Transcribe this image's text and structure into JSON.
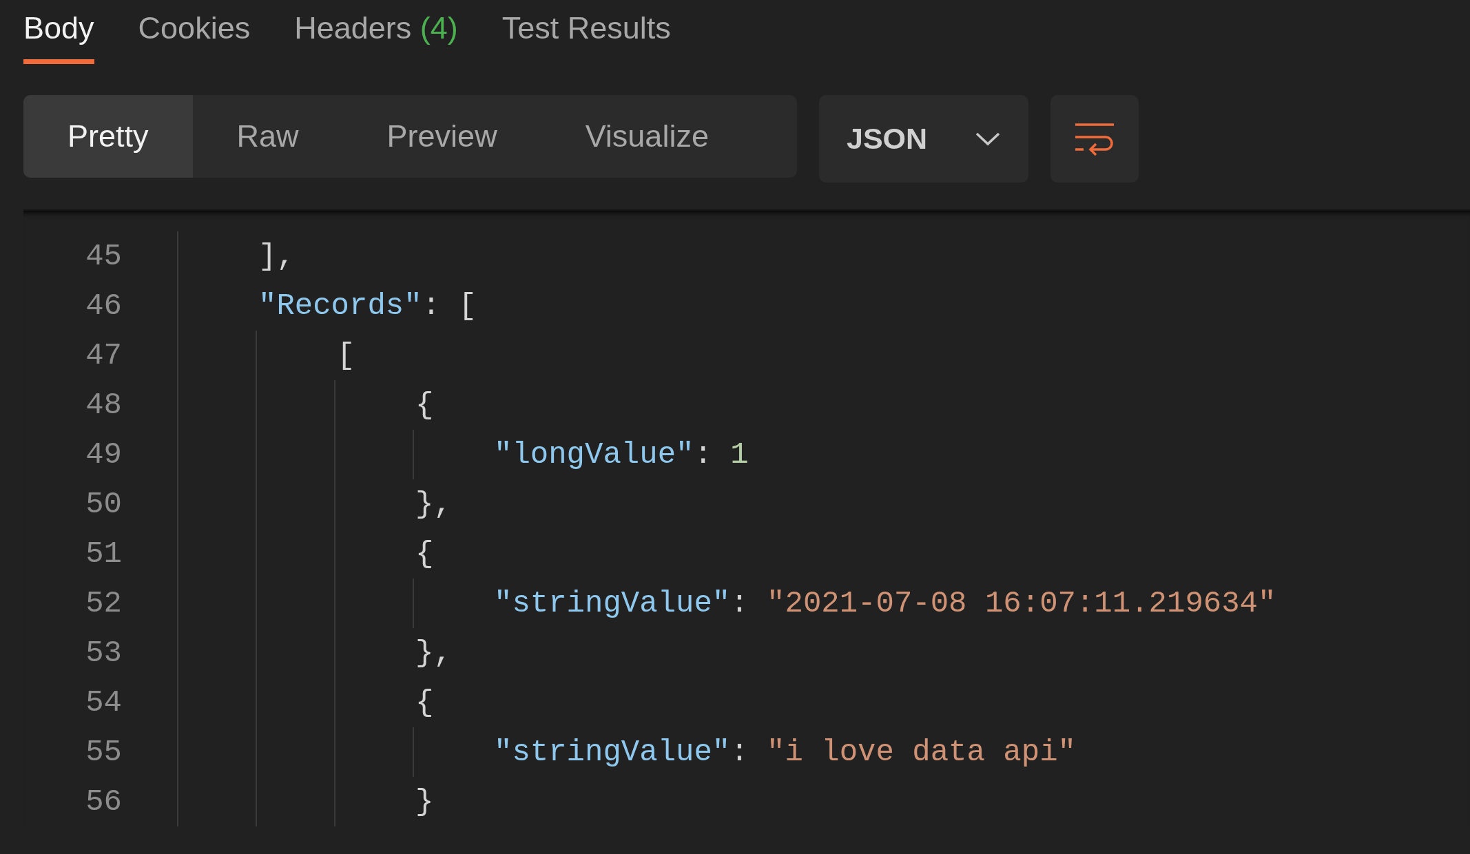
{
  "tabs": [
    {
      "label": "Body",
      "selected": true
    },
    {
      "label": "Cookies",
      "selected": false
    },
    {
      "label": "Headers",
      "count": "(4)",
      "selected": false
    },
    {
      "label": "Test Results",
      "selected": false
    }
  ],
  "view_modes": [
    {
      "label": "Pretty",
      "selected": true
    },
    {
      "label": "Raw",
      "selected": false
    },
    {
      "label": "Preview",
      "selected": false
    },
    {
      "label": "Visualize",
      "selected": false
    }
  ],
  "format_dropdown": {
    "value": "JSON"
  },
  "wrap_button": {
    "on": true
  },
  "code_lines": [
    {
      "number": "45",
      "tokens": [
        {
          "kind": "punct",
          "text": "],"
        }
      ]
    },
    {
      "number": "46",
      "tokens": [
        {
          "kind": "key",
          "text": "\"Records\""
        },
        {
          "kind": "punct",
          "text": ": ["
        }
      ],
      "children": [
        {
          "number": "47",
          "tokens": [
            {
              "kind": "punct",
              "text": "["
            }
          ],
          "children": [
            {
              "number": "48",
              "tokens": [
                {
                  "kind": "punct",
                  "text": "{"
                }
              ],
              "children": [
                {
                  "number": "49",
                  "tokens": [
                    {
                      "kind": "key",
                      "text": "\"longValue\""
                    },
                    {
                      "kind": "punct",
                      "text": ": "
                    },
                    {
                      "kind": "number",
                      "text": "1"
                    }
                  ]
                }
              ]
            },
            {
              "number": "50",
              "tokens": [
                {
                  "kind": "punct",
                  "text": "},"
                }
              ]
            },
            {
              "number": "51",
              "tokens": [
                {
                  "kind": "punct",
                  "text": "{"
                }
              ],
              "children": [
                {
                  "number": "52",
                  "tokens": [
                    {
                      "kind": "key",
                      "text": "\"stringValue\""
                    },
                    {
                      "kind": "punct",
                      "text": ": "
                    },
                    {
                      "kind": "string",
                      "text": "\"2021-07-08 16:07:11.219634\""
                    }
                  ]
                }
              ]
            },
            {
              "number": "53",
              "tokens": [
                {
                  "kind": "punct",
                  "text": "},"
                }
              ]
            },
            {
              "number": "54",
              "tokens": [
                {
                  "kind": "punct",
                  "text": "{"
                }
              ],
              "children": [
                {
                  "number": "55",
                  "tokens": [
                    {
                      "kind": "key",
                      "text": "\"stringValue\""
                    },
                    {
                      "kind": "punct",
                      "text": ": "
                    },
                    {
                      "kind": "string",
                      "text": "\"i love data api\""
                    }
                  ]
                }
              ]
            },
            {
              "number": "56",
              "tokens": [
                {
                  "kind": "punct",
                  "text": "}"
                }
              ]
            }
          ]
        }
      ]
    }
  ]
}
